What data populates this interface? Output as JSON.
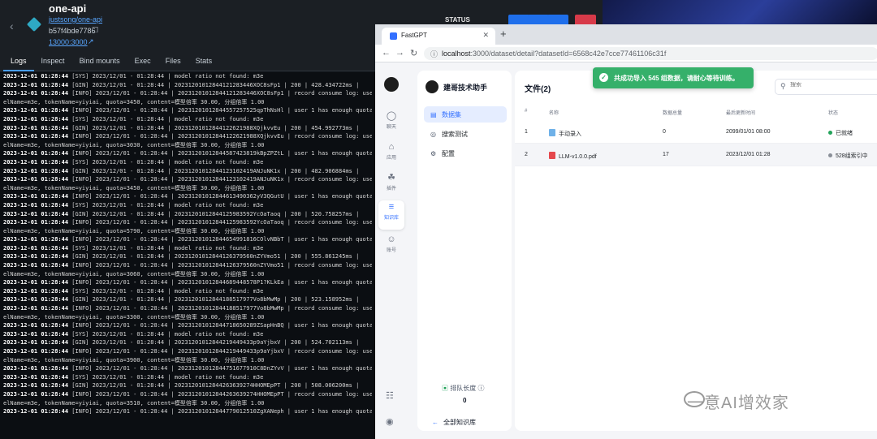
{
  "docker": {
    "container_name": "one-api",
    "image": "justsong/one-api",
    "container_id": "b57f4bde7786",
    "port": "13000:3000",
    "tabs": [
      "Logs",
      "Inspect",
      "Bind mounts",
      "Exec",
      "Files",
      "Stats"
    ],
    "active_tab": "Logs",
    "status_label": "STATUS",
    "log_lines": [
      {
        "ts": "2023-12-01 01:28:44",
        "msg": "[SYS] 2023/12/01 - 01:28:44 | model ratio not found: m3e"
      },
      {
        "ts": "2023-12-01 01:28:44",
        "msg": "[GIN] 2023/12/01 - 01:28:44 | 20231201012844121283446XOC8sFp1 | 200 |   428.434722ms |"
      },
      {
        "ts": "2023-12-01 01:28:44",
        "msg": "[INFO] 2023/12/01 - 01:28:44 | 20231201012844121283446XOC8sFp1 | record consume log: userId"
      },
      {
        "ts": "",
        "msg": "elName=m3e, tokenName=yiyiai, quota=3450, content=模型倍率 30.00, 分组倍率 1.00"
      },
      {
        "ts": "2023-12-01 01:28:44",
        "msg": "[INFO] 2023/12/01 - 01:28:44 | 20231201012844557257525qpThNsHl | user 1 has enough quota 92"
      },
      {
        "ts": "2023-12-01 01:28:44",
        "msg": "[SYS] 2023/12/01 - 01:28:44 | model ratio not found: m3e"
      },
      {
        "ts": "2023-12-01 01:28:44",
        "msg": "[GIN] 2023/12/01 - 01:28:44 | 20231201012844122621988XQjkvvEu | 200 |   454.992773ms |"
      },
      {
        "ts": "2023-12-01 01:28:44",
        "msg": "[INFO] 2023/12/01 - 01:28:44 | 20231201012844122621988XQjkvvEu | record consume log: userId"
      },
      {
        "ts": "",
        "msg": "elName=m3e, tokenName=yiyiai, quota=3030, content=模型倍率 30.00, 分组倍率 1.00"
      },
      {
        "ts": "2023-12-01 01:28:44",
        "msg": "[INFO] 2023/12/01 - 01:28:44 | 20231201012844587423819kBpZPZtL | user 1 has enough quota 92"
      },
      {
        "ts": "2023-12-01 01:28:44",
        "msg": "[SYS] 2023/12/01 - 01:28:44 | model ratio not found: m3e"
      },
      {
        "ts": "2023-12-01 01:28:44",
        "msg": "[GIN] 2023/12/01 - 01:28:44 | 20231201012844123102419ANJuNK1x | 200 |   482.906884ms |"
      },
      {
        "ts": "2023-12-01 01:28:44",
        "msg": "[INFO] 2023/12/01 - 01:28:44 | 20231201012844123102419ANJuNK1x | record consume log: userId"
      },
      {
        "ts": "",
        "msg": "elName=m3e, tokenName=yiyiai, quota=3450, content=模型倍率 30.00, 分组倍率 1.00"
      },
      {
        "ts": "2023-12-01 01:28:44",
        "msg": "[INFO] 2023/12/01 - 01:28:44 | 20231201012844613490362yV3QGutU | user 1 has enough quota 92"
      },
      {
        "ts": "2023-12-01 01:28:44",
        "msg": "[SYS] 2023/12/01 - 01:28:44 | model ratio not found: m3e"
      },
      {
        "ts": "2023-12-01 01:28:44",
        "msg": "[GIN] 2023/12/01 - 01:28:44 | 20231201012844125983592YcOaTaoq | 200 |   520.758257ms |"
      },
      {
        "ts": "2023-12-01 01:28:44",
        "msg": "[INFO] 2023/12/01 - 01:28:44 | 20231201012844125983592YcOaTaoq | record consume log: userId"
      },
      {
        "ts": "",
        "msg": "elName=m3e, tokenName=yiyiai, quota=5790, content=模型倍率 30.00, 分组倍率 1.00"
      },
      {
        "ts": "2023-12-01 01:28:44",
        "msg": "[INFO] 2023/12/01 - 01:28:44 | 20231201012844654991816COlvNBbT | user 1 has enough quota 92"
      },
      {
        "ts": "2023-12-01 01:28:44",
        "msg": "[SYS] 2023/12/01 - 01:28:44 | model ratio not found: m3e"
      },
      {
        "ts": "2023-12-01 01:28:44",
        "msg": "[GIN] 2023/12/01 - 01:28:44 | 20231201012844126379560nZYVmo51 | 200 |   555.861245ms |"
      },
      {
        "ts": "2023-12-01 01:28:44",
        "msg": "[INFO] 2023/12/01 - 01:28:44 | 20231201012844126379560nZYVmo51 | record consume log: userId"
      },
      {
        "ts": "",
        "msg": "elName=m3e, tokenName=yiyiai, quota=3060, content=模型倍率 30.00, 分组倍率 1.00"
      },
      {
        "ts": "2023-12-01 01:28:44",
        "msg": "[INFO] 2023/12/01 - 01:28:44 | 20231201012844689448578P1?KLkEa | user 1 has enough quota 92"
      },
      {
        "ts": "2023-12-01 01:28:44",
        "msg": "[SYS] 2023/12/01 - 01:28:44 | model ratio not found: m3e"
      },
      {
        "ts": "2023-12-01 01:28:44",
        "msg": "[GIN] 2023/12/01 - 01:28:44 | 20231201012844188517977Vo8bMwMp | 200 |   523.158952ms |"
      },
      {
        "ts": "2023-12-01 01:28:44",
        "msg": "[INFO] 2023/12/01 - 01:28:44 | 20231201012844188517977Vo8bMwMp | record consume log: userId"
      },
      {
        "ts": "",
        "msg": "elName=m3e, tokenName=yiyiai, quota=3300, content=模型倍率 30.00, 分组倍率 1.00"
      },
      {
        "ts": "2023-12-01 01:28:44",
        "msg": "[INFO] 2023/12/01 - 01:28:44 | 20231201012844718650289ZSapHnBQ | user 1 has enough quota 92"
      },
      {
        "ts": "2023-12-01 01:28:44",
        "msg": "[SYS] 2023/12/01 - 01:28:44 | model ratio not found: m3e"
      },
      {
        "ts": "2023-12-01 01:28:44",
        "msg": "[GIN] 2023/12/01 - 01:28:44 | 20231201012844219449433p9aYjbxV | 200 |   524.702113ms |"
      },
      {
        "ts": "2023-12-01 01:28:44",
        "msg": "[INFO] 2023/12/01 - 01:28:44 | 20231201012844219449433p9aYjbxV | record consume log: userId"
      },
      {
        "ts": "",
        "msg": "elName=m3e, tokenName=yiyiai, quota=3900, content=模型倍率 30.00, 分组倍率 1.00"
      },
      {
        "ts": "2023-12-01 01:28:44",
        "msg": "[INFO] 2023/12/01 - 01:28:44 | 20231201012844751677910C8DnZYvV | user 1 has enough quota 92"
      },
      {
        "ts": "2023-12-01 01:28:44",
        "msg": "[SYS] 2023/12/01 - 01:28:44 | model ratio not found: m3e"
      },
      {
        "ts": "2023-12-01 01:28:44",
        "msg": "[GIN] 2023/12/01 - 01:28:44 | 20231201012844263639274HHOMEpPT | 200 |   508.006200ms |"
      },
      {
        "ts": "2023-12-01 01:28:44",
        "msg": "[INFO] 2023/12/01 - 01:28:44 | 20231201012844263639274HHOMEpPT | record consume log: userId"
      },
      {
        "ts": "",
        "msg": "elName=m3e, tokenName=yiyiai, quota=3510, content=模型倍率 30.00, 分组倍率 1.00"
      },
      {
        "ts": "2023-12-01 01:28:44",
        "msg": "[INFO] 2023/12/01 - 01:28:44 | 20231201012844779012510ZgXANeph | user 1 has enough quota 92"
      }
    ]
  },
  "browser": {
    "tab_title": "FastGPT",
    "url_host": "localhost",
    "url_rest": ":3000/dataset/detail?datasetId=6568c42e7cce77461106c31f"
  },
  "app": {
    "rail": [
      {
        "label": "聊天",
        "icon": "chat-icon"
      },
      {
        "label": "应用",
        "icon": "robot-icon"
      },
      {
        "label": "插件",
        "icon": "plugin-icon"
      },
      {
        "label": "知识库",
        "icon": "database-icon"
      },
      {
        "label": "账号",
        "icon": "user-icon"
      }
    ],
    "rail_active": "知识库",
    "kb_name": "建哥技术助手",
    "kb_menu": [
      "数据集",
      "搜索测试",
      "配置"
    ],
    "kb_menu_active": "数据集",
    "queue_label": "排队长度",
    "queue_value": "0",
    "all_kb_label": "全部知识库",
    "files_title": "文件(2)",
    "search_placeholder": "搜索",
    "toast_text": "共成功导入 545 组数据，请耐心等待训练。",
    "table": {
      "headers": [
        "#",
        "名称",
        "数据总量",
        "最后更新时间",
        "状态"
      ],
      "rows": [
        {
          "index": "1",
          "name": "手动录入",
          "type": "manual",
          "total": "0",
          "updated": "2099/01/01 08:00",
          "status": "已就绪",
          "status_color": "#22a35a"
        },
        {
          "index": "2",
          "name": "LLM-v1.0.0.pdf",
          "type": "pdf",
          "total": "17",
          "updated": "2023/12/01 01:28",
          "status": "528组索引中",
          "status_color": "#8a8f98"
        }
      ]
    },
    "colors": {
      "accent": "#3370ff",
      "toast": "#35b06a"
    }
  },
  "watermark": "一意AI增效家"
}
